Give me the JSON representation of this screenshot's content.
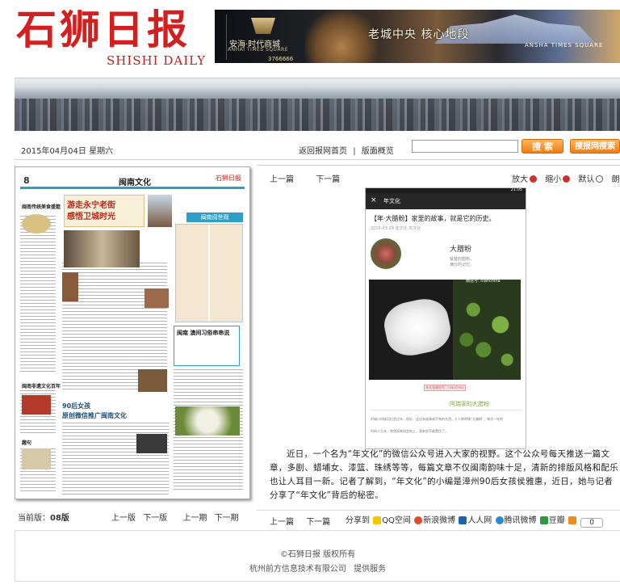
{
  "header": {
    "logo_cn": "石狮日报",
    "logo_en": "SHISHI DAILY",
    "ad": {
      "brand_cn": "安海·时代商城",
      "brand_en": "ANHAI TIMES SQUARE",
      "phone": "3766666",
      "slogan": "老城中央 核心地段",
      "slogan_en": "ANSHA TIMES SQUARE"
    }
  },
  "topbar": {
    "date": "2015年04月04日 星期六",
    "nav": [
      "返回报网首页",
      "|",
      "版面概览"
    ],
    "search_placeholder": "",
    "search_button": "搜 索",
    "site_search_button": "搜报网搜索"
  },
  "newspaper_page": {
    "page_number": "8",
    "section_title": "闽南文化",
    "masthead": "石狮日报",
    "headline_1": "游走永宁老街",
    "headline_2": "感悟卫城时光",
    "comic_title": "闽南阅世观",
    "box_title": "闽南 澳间习俗串串说",
    "headline_3": "90后女孩",
    "headline_3b": "原创微信推广闽南文化",
    "side_1": "闽南传统美食盛筵",
    "side_2": "闽南非遗文化百年",
    "side_3": "趣句"
  },
  "edition": {
    "label": "当前版：",
    "value": "08版",
    "links": [
      "上一版",
      "下一版",
      "上一期",
      "下一期"
    ]
  },
  "article": {
    "nav": [
      "上一篇",
      "下一篇"
    ],
    "tools": [
      "放大",
      "缩小",
      "默认",
      "朗读"
    ],
    "phone": {
      "status_time": "21:05",
      "bar_title": "年文化",
      "close": "×",
      "title": "【年·大腊粉】家里的故事，就是它的历史。",
      "meta": "2015-03-29  年文化  年文化",
      "name": "大腊粉",
      "sub1": "爸爸的腊粉，",
      "sub2": "满分的记忆。",
      "wechat": "微信号: nianchina",
      "ribbon": "年文化微信号：nianchina",
      "caption": "阿瑞家的大腊粉",
      "text1": "阿瑞小时候记忆里过年，很好，这还有道弗成不常的东西，大人称呼做“大腊粉”，每次一吃的",
      "text2": "时间十几年，突然再有机会吃上，我有些不敢置信了。"
    },
    "body": "近日，一个名为“年文化”的微信公众号进入大家的视野。这个公众号每天推送一篇文章，多剧、蜡埔女、漆篮、珠绣等等，每篇文章不仅闽南韵味十足，清新的排版风格和配乐也让人耳目一新。记者了解到，“年文化”的小编是漳州90后女孩侯雅惠，近日，她与记者分享了“年文化”背后的秘密。",
    "bottom_nav": [
      "上一篇",
      "下一篇"
    ],
    "share_label": "分享到",
    "share": [
      "QQ空间",
      "新浪微博",
      "人人网",
      "腾讯微博",
      "豆瓣"
    ],
    "share_count": "0"
  },
  "footer": {
    "copyright": "©石狮日报 版权所有",
    "tech": [
      "杭州前方信息技术有限公司",
      "提供服务"
    ]
  },
  "colors": {
    "logo_red": "#d21f1f",
    "button_orange": "#f07d10",
    "section_blue": "#2aa0c8"
  }
}
